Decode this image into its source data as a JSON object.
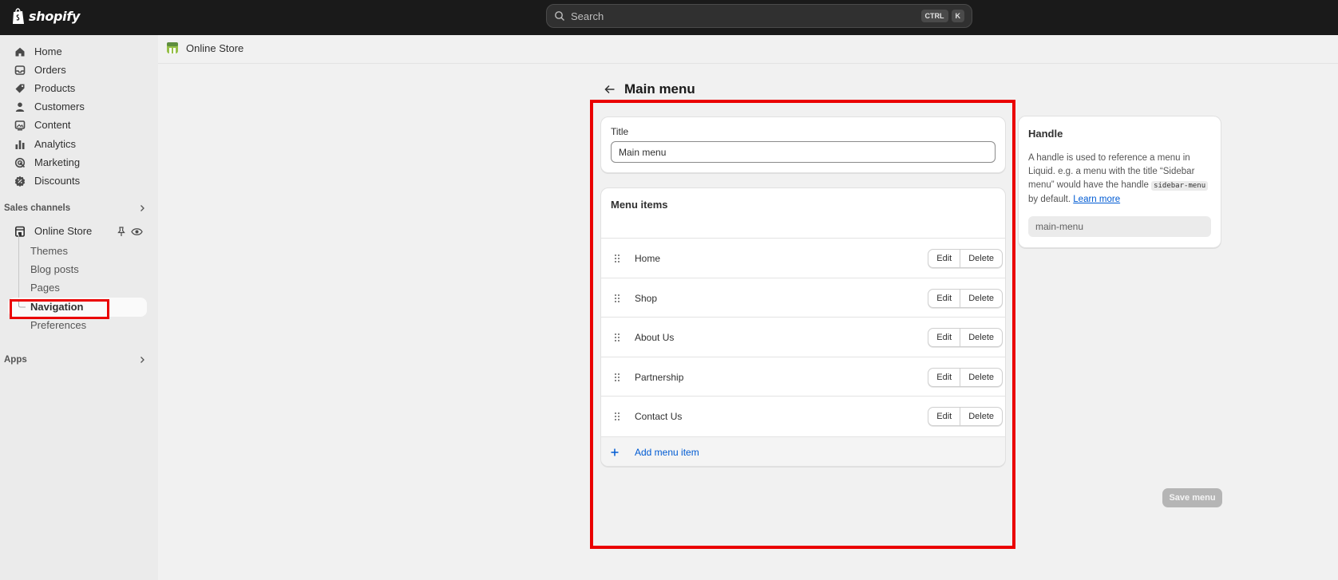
{
  "topbar": {
    "brand": "shopify",
    "search_placeholder": "Search",
    "shortcut_keys": [
      "CTRL",
      "K"
    ]
  },
  "sidebar": {
    "items": [
      {
        "label": "Home",
        "icon": "home-icon"
      },
      {
        "label": "Orders",
        "icon": "inbox-icon"
      },
      {
        "label": "Products",
        "icon": "tag-icon"
      },
      {
        "label": "Customers",
        "icon": "person-icon"
      },
      {
        "label": "Content",
        "icon": "image-icon"
      },
      {
        "label": "Analytics",
        "icon": "bar-chart-icon"
      },
      {
        "label": "Marketing",
        "icon": "target-icon"
      },
      {
        "label": "Discounts",
        "icon": "discount-icon"
      }
    ],
    "sales_channels_label": "Sales channels",
    "online_store_label": "Online Store",
    "sub_items": [
      "Themes",
      "Blog posts",
      "Pages",
      "Navigation",
      "Preferences"
    ],
    "apps_label": "Apps"
  },
  "breadcrumb": {
    "label": "Online Store"
  },
  "page": {
    "title": "Main menu"
  },
  "title_card": {
    "label": "Title",
    "value": "Main menu"
  },
  "menu_card": {
    "header": "Menu items",
    "items": [
      "Home",
      "Shop",
      "About Us",
      "Partnership",
      "Contact Us"
    ],
    "edit_label": "Edit",
    "delete_label": "Delete",
    "add_label": "Add menu item"
  },
  "handle_card": {
    "title": "Handle",
    "desc_1": "A handle is used to reference a menu in Liquid. e.g. a menu with the title “Sidebar menu” would have the handle",
    "code": "sidebar-menu",
    "desc_2": "by default.",
    "link": "Learn more",
    "value": "main-menu"
  },
  "save_label": "Save menu",
  "colors": {
    "topbar": "#1a1a1a",
    "highlight": "#ea0000",
    "link": "#005bd3"
  }
}
